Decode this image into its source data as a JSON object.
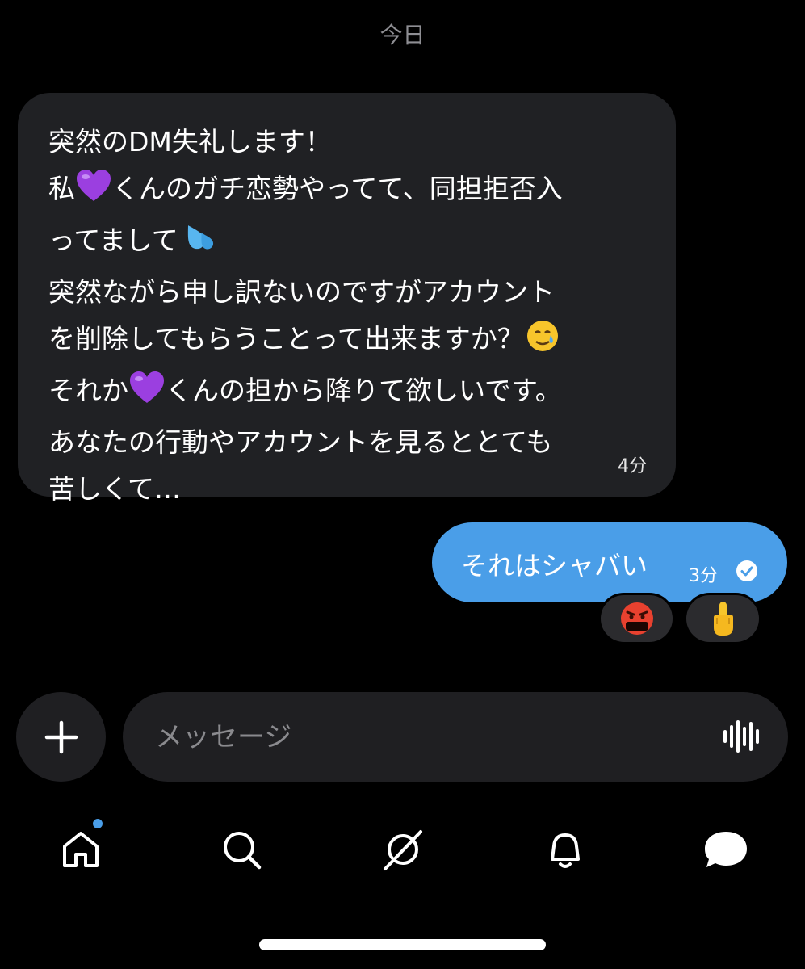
{
  "date_separator": "今日",
  "incoming": {
    "lines": [
      {
        "before": "突然のDM失礼します！",
        "emoji": "",
        "after": ""
      },
      {
        "before": "私",
        "emoji": "purple-heart",
        "after": "くんのガチ恋勢やってて、同担拒否入"
      },
      {
        "before": "ってまして",
        "emoji": "sweat-droplets",
        "after": ""
      },
      {
        "before": "突然ながら申し訳ないのですがアカウント",
        "emoji": "",
        "after": ""
      },
      {
        "before": "を削除してもらうことって出来ますか？",
        "emoji": "smiling-face-with-tear",
        "after": ""
      },
      {
        "before": "それか",
        "emoji": "purple-heart",
        "after": "くんの担から降りて欲しいです。"
      },
      {
        "before": "あなたの行動やアカウントを見るととても",
        "emoji": "",
        "after": ""
      },
      {
        "before": "苦しくて…",
        "emoji": "",
        "after": ""
      }
    ],
    "time": "4分"
  },
  "outgoing": {
    "text": "それはシャバい",
    "time": "3分",
    "status_icon": "check-circle-icon"
  },
  "reactions": [
    {
      "icon": "face-with-symbols-on-mouth-emoji",
      "symbols": "&$!#%"
    },
    {
      "icon": "middle-finger-emoji"
    }
  ],
  "composer": {
    "placeholder": "メッセージ",
    "left_button_icon": "plus-icon",
    "right_icon": "voice-waveform-icon"
  },
  "tabs": [
    {
      "name": "home",
      "icon": "home-icon",
      "has_badge": true
    },
    {
      "name": "search",
      "icon": "search-icon"
    },
    {
      "name": "grok",
      "icon": "grok-icon"
    },
    {
      "name": "notifications",
      "icon": "bell-icon"
    },
    {
      "name": "messages",
      "icon": "chat-bubble-icon",
      "active": true
    }
  ],
  "colors": {
    "background": "#000000",
    "incoming_bubble": "#202124",
    "outgoing_bubble": "#4a9ee8",
    "accent": "#4a9ee8"
  }
}
